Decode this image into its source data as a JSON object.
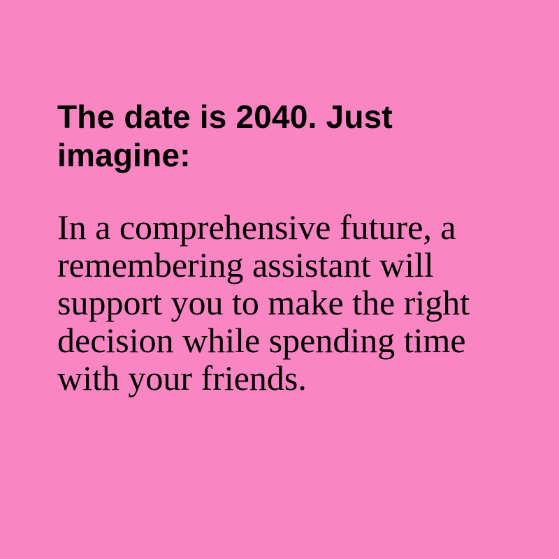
{
  "colors": {
    "background": "#f985c3",
    "text": "#000000"
  },
  "heading": "The date is 2040. Just imagine:",
  "body": "In a comprehensive future, a remembering assistant will support you to make the right decision while spending time with your friends."
}
